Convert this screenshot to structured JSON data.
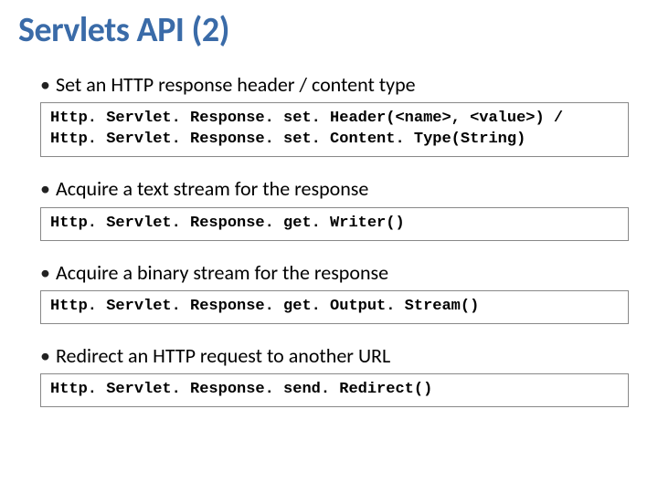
{
  "title": "Servlets API (2)",
  "items": [
    {
      "bullet_text": "Set an HTTP response header / content type",
      "code": "Http. Servlet. Response. set. Header(<name>, <value>) /\nHttp. Servlet. Response. set. Content. Type(String)"
    },
    {
      "bullet_text": "Acquire a text stream for the response",
      "code": "Http. Servlet. Response. get. Writer()"
    },
    {
      "bullet_text": "Acquire a binary stream for the response",
      "code": "Http. Servlet. Response. get. Output. Stream()"
    },
    {
      "bullet_text": "Redirect an HTTP request to another URL",
      "code": "Http. Servlet. Response. send. Redirect()"
    }
  ]
}
